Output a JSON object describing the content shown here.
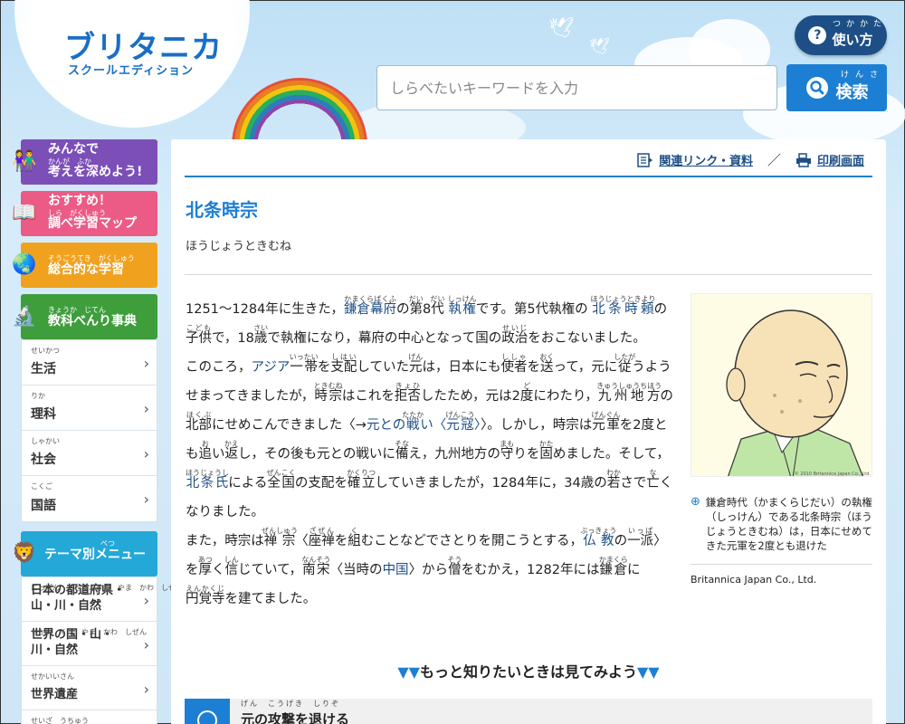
{
  "header": {
    "logo_main": "ブリタニカ",
    "logo_sub": "スクールエディション",
    "help_label": "使い方",
    "help_ruby": "つかかた",
    "search_placeholder": "しらべたいキーワードを入力",
    "search_label": "検索",
    "search_ruby": "けんさく"
  },
  "sidebar": {
    "buttons": [
      {
        "ruby": "かんが　ふか",
        "line1": "みんなで",
        "line2": "考えを深めよう!",
        "icon": "people-icon"
      },
      {
        "ruby": "しら　がくしゅう",
        "line1": "おすすめ！",
        "line2": "調べ学習マップ",
        "icon": "book-icon"
      },
      {
        "ruby": "そうごうてき　がくしゅう",
        "line1": "総合的な学習",
        "icon": "globe-icon"
      },
      {
        "ruby": "きょうか　じてん",
        "line1": "教科べんり事典",
        "icon": "microscope-icon"
      }
    ],
    "subjects": [
      {
        "ruby": "せいかつ",
        "label": "生活"
      },
      {
        "ruby": "りか",
        "label": "理科"
      },
      {
        "ruby": "しゃかい",
        "label": "社会"
      },
      {
        "ruby": "こくご",
        "label": "国語"
      }
    ],
    "theme_button": {
      "ruby": "べつ",
      "label": "テーマ別メニュー"
    },
    "themes": [
      {
        "ruby": "にっぽん　とどうふけん　やま　かわ　しぜん",
        "label": "日本の都道府県・山・川・自然"
      },
      {
        "ruby": "せかい　くに　やま　かわ　しぜん",
        "label": "世界の国・山・川・自然"
      },
      {
        "ruby": "せかいいさん",
        "label": "世界遺産"
      },
      {
        "ruby": "せいざ　うちゅう",
        "label": ""
      }
    ]
  },
  "article": {
    "related_link": "関連リンク・資料",
    "print_link": "印刷画面",
    "slash": "／",
    "title": "北条時宗",
    "reading": "ほうじょうときむね",
    "figure_caption": "鎌倉時代（かまくらじだい）の執権（しっけん）である北条時宗（ほうじょうときむね）は，日本にせめてきた元軍を2度とも退けた",
    "figure_credit": "Britannica Japan Co., Ltd.",
    "portrait_copyright": "© 2010 Britannica Japan Co., Ltd.",
    "more_label": "もっと知りたいときは見てみよう",
    "related_item": "元の攻撃を退ける",
    "related_ruby": "げん　こうげき　しりぞ"
  },
  "colors": {
    "accent": "#1c7fd4",
    "navy": "#1d4f86",
    "purple": "#7b4fb7",
    "pink": "#ec5a86",
    "orange": "#f0a21f",
    "green": "#3e9e3c",
    "teal": "#23a8d8"
  }
}
